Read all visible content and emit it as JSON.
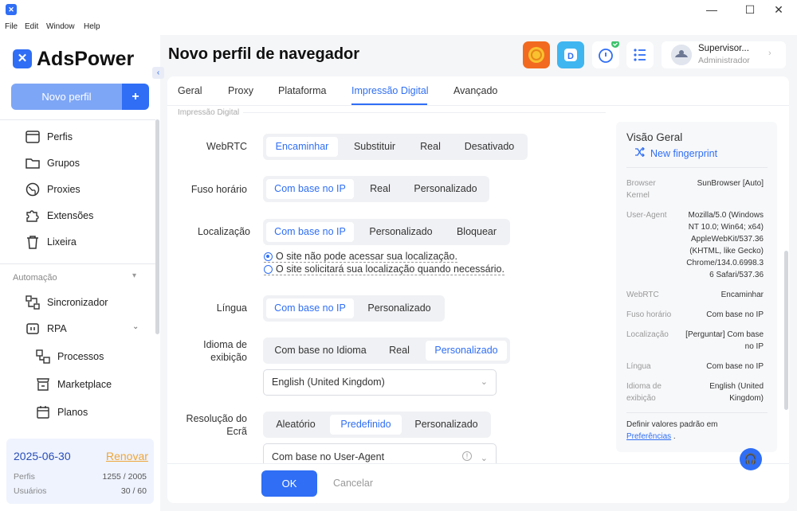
{
  "menu": [
    "File",
    "Edit",
    "Window",
    "Help"
  ],
  "app": {
    "name": "AdsPower"
  },
  "sidebar": {
    "new_profile": "Novo perfil",
    "items": [
      {
        "label": "Perfis"
      },
      {
        "label": "Grupos"
      },
      {
        "label": "Proxies"
      },
      {
        "label": "Extensões"
      },
      {
        "label": "Lixeira"
      }
    ],
    "automation_label": "Automação",
    "auto_items": [
      {
        "label": "Sincronizador"
      },
      {
        "label": "RPA"
      }
    ],
    "rpa_sub": [
      {
        "label": "Processos"
      },
      {
        "label": "Marketplace"
      },
      {
        "label": "Planos"
      }
    ],
    "expiry": "2025-06-30",
    "renew": "Renovar",
    "stats": [
      {
        "label": "Perfis",
        "value": "1255 / 2005"
      },
      {
        "label": "Usuários",
        "value": "30 / 60"
      }
    ]
  },
  "header": {
    "title": "Novo perfil de navegador",
    "user_name": "Supervisor...",
    "user_role": "Administrador"
  },
  "tabs": [
    "Geral",
    "Proxy",
    "Plataforma",
    "Impressão Digital",
    "Avançado"
  ],
  "form": {
    "section": "Impressão Digital",
    "webrtc": {
      "label": "WebRTC",
      "options": [
        "Encaminhar",
        "Substituir",
        "Real",
        "Desativado"
      ]
    },
    "timezone": {
      "label": "Fuso horário",
      "options": [
        "Com base no IP",
        "Real",
        "Personalizado"
      ]
    },
    "location": {
      "label": "Localização",
      "options": [
        "Com base no IP",
        "Personalizado",
        "Bloquear"
      ],
      "radios": [
        "O site não pode acessar sua localização.",
        "O site solicitará sua localização quando necessário."
      ]
    },
    "language": {
      "label": "Língua",
      "options": [
        "Com base no IP",
        "Personalizado"
      ]
    },
    "display_lang": {
      "label1": "Idioma de",
      "label2": "exibição",
      "options": [
        "Com base no Idioma",
        "Real",
        "Personalizado"
      ],
      "value": "English (United Kingdom)"
    },
    "resolution": {
      "label1": "Resolução do",
      "label2": "Ecrã",
      "options": [
        "Aleatório",
        "Predefinido",
        "Personalizado"
      ],
      "value": "Com base no User-Agent"
    }
  },
  "footer": {
    "ok": "OK",
    "cancel": "Cancelar"
  },
  "overview": {
    "title": "Visão Geral",
    "new_fp": "New fingerprint",
    "rows": [
      {
        "k1": "Browser",
        "k2": "Kernel",
        "v1": "SunBrowser [Auto]"
      },
      {
        "k1": "User-Agent",
        "v1": "Mozilla/5.0 (Windows",
        "v2": "NT 10.0; Win64; x64)",
        "v3": "AppleWebKit/537.36",
        "v4": "(KHTML, like Gecko)",
        "v5": "Chrome/134.0.6998.3",
        "v6": "6 Safari/537.36"
      },
      {
        "k1": "WebRTC",
        "v1": "Encaminhar"
      },
      {
        "k1": "Fuso horário",
        "v1": "Com base no IP"
      },
      {
        "k1": "Localização",
        "v1": "[Perguntar] Com base",
        "v2": "no IP"
      },
      {
        "k1": "Língua",
        "v1": "Com base no IP"
      },
      {
        "k1": "Idioma de",
        "k2": "exibição",
        "v1": "English (United",
        "v2": "Kingdom)"
      }
    ],
    "defaults_text": "Definir valores padrão em",
    "defaults_link": "Preferências",
    "defaults_end": "."
  }
}
